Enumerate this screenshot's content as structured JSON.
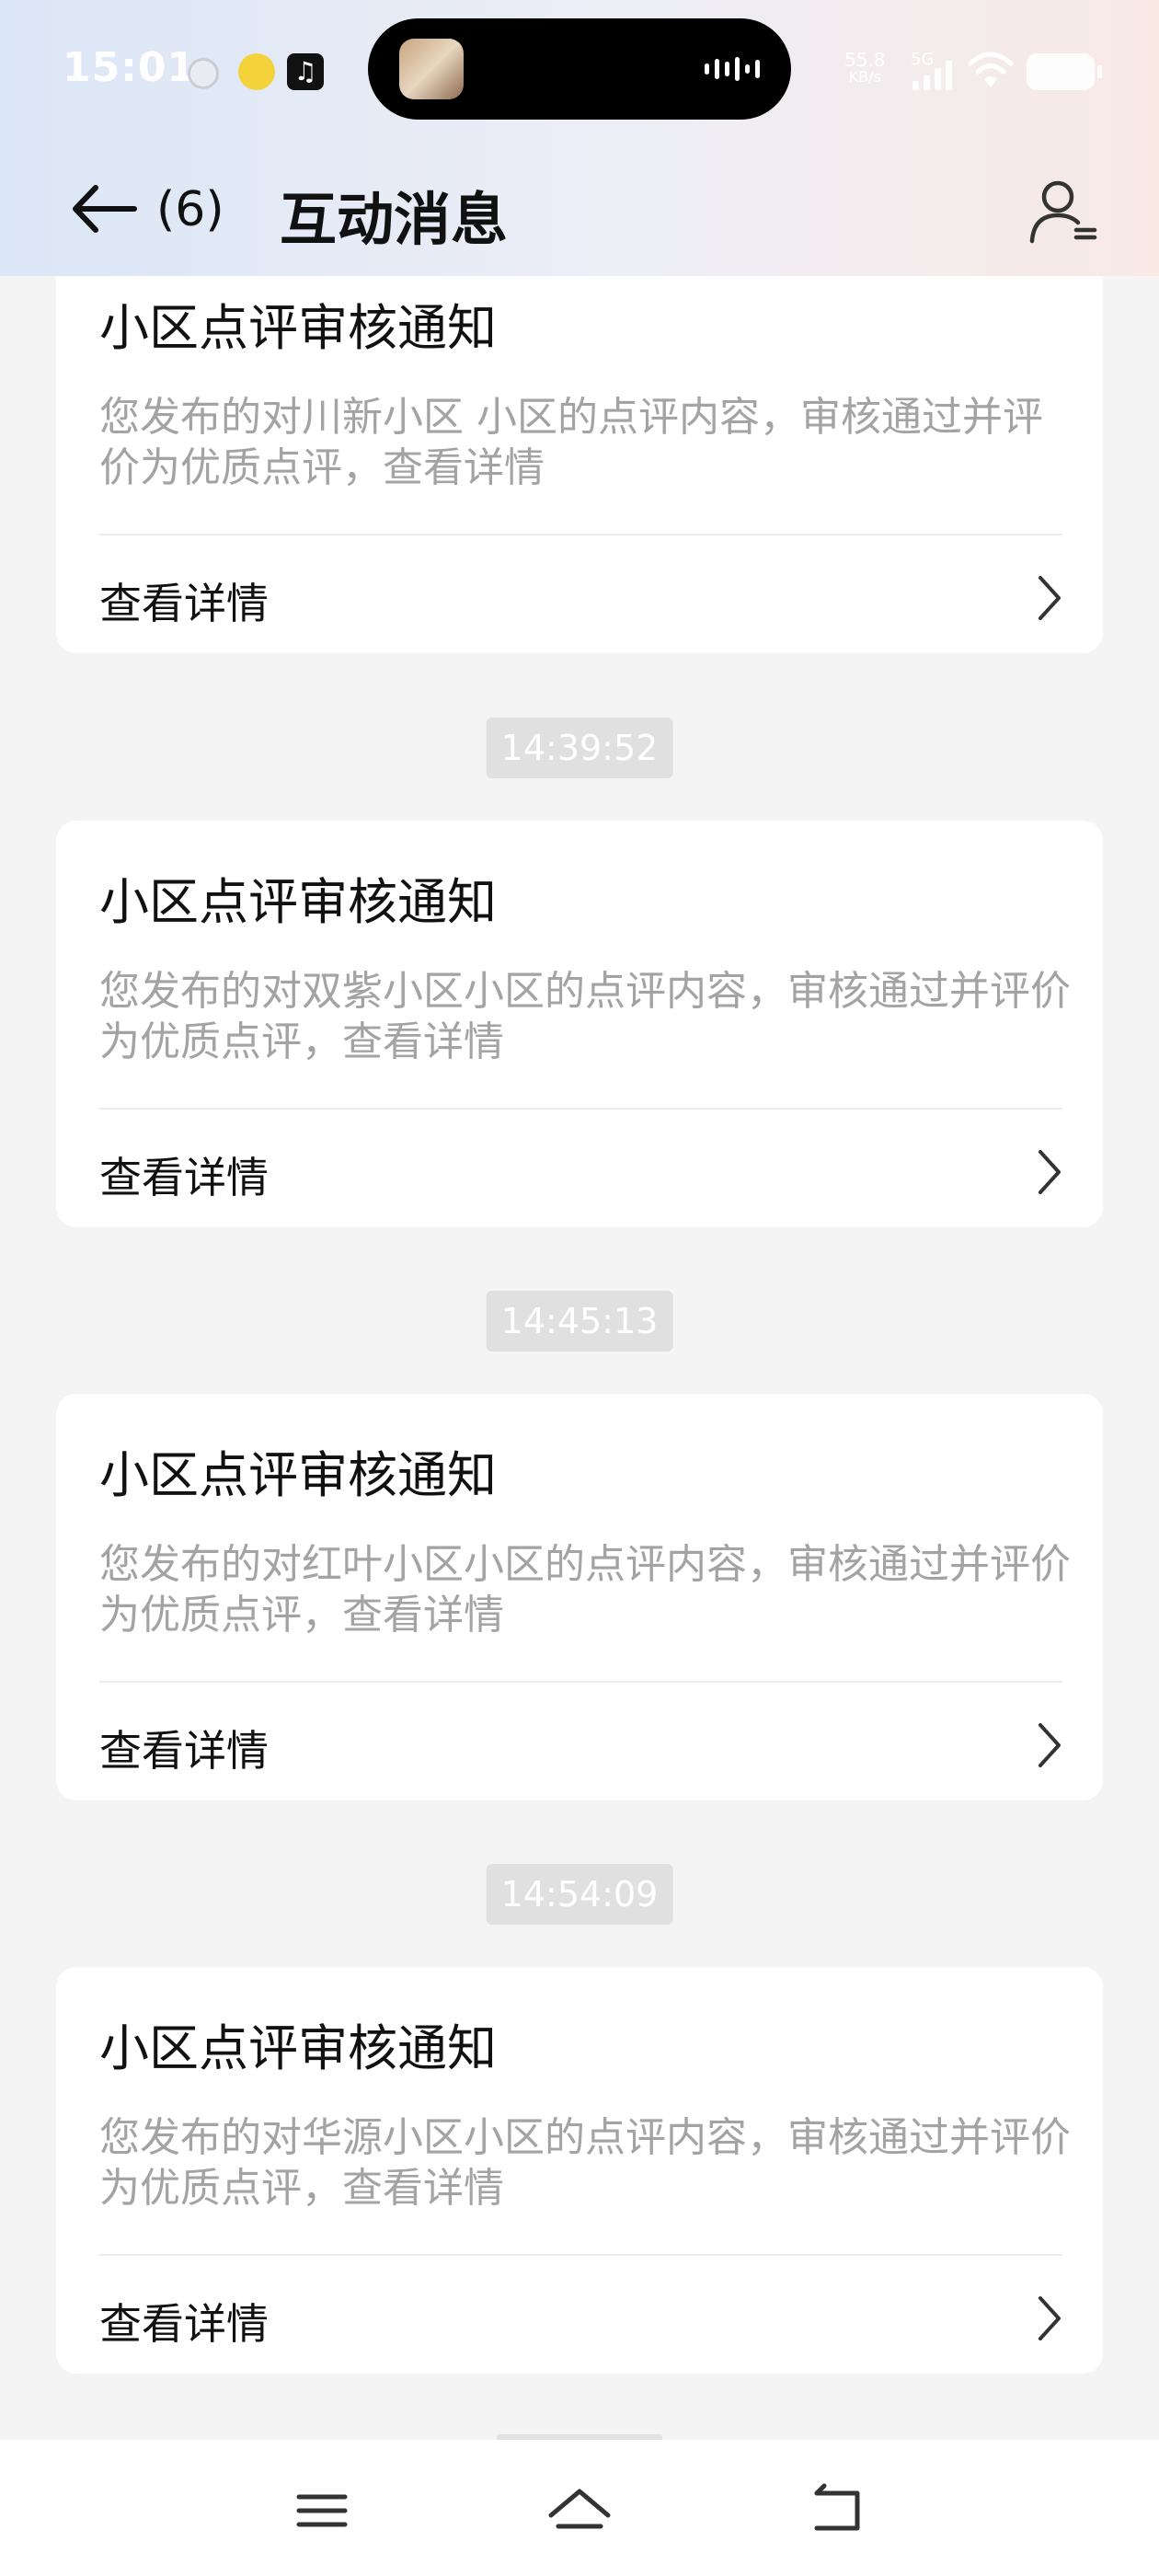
{
  "status_bar": {
    "time": "15:01",
    "net_speed_value": "55.8",
    "net_speed_unit": "KB/s",
    "network_type": "5G"
  },
  "header": {
    "count": "(6)",
    "title": "互动消息"
  },
  "messages": [
    {
      "time": "",
      "title": "小区点评审核通知",
      "body": "您发布的对川新小区 小区的点评内容，审核通过并评价为优质点评，查看详情",
      "link": "查看详情"
    },
    {
      "time": "14:39:52",
      "title": "小区点评审核通知",
      "body": "您发布的对双紫小区小区的点评内容，审核通过并评价为优质点评，查看详情",
      "link": "查看详情"
    },
    {
      "time": "14:45:13",
      "title": "小区点评审核通知",
      "body": "您发布的对红叶小区小区的点评内容，审核通过并评价为优质点评，查看详情",
      "link": "查看详情"
    },
    {
      "time": "14:54:09",
      "title": "小区点评审核通知",
      "body": "您发布的对华源小区小区的点评内容，审核通过并评价为优质点评，查看详情",
      "link": "查看详情"
    }
  ],
  "icons": {
    "back": "arrow-left-icon",
    "profile": "user-settings-icon",
    "chevron": "chevron-right-icon",
    "nav_menu": "menu-icon",
    "nav_home": "home-icon",
    "nav_back": "return-icon"
  },
  "colors": {
    "text_primary": "#111111",
    "text_secondary": "#a3a3a3",
    "badge_bg": "#e0e0e0",
    "page_bg": "#f4f4f4"
  }
}
